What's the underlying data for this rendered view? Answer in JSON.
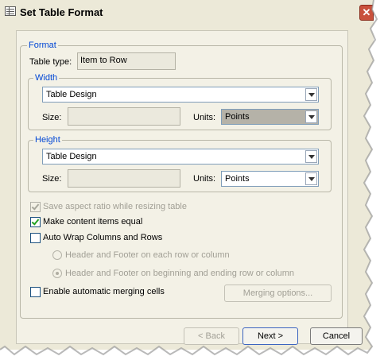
{
  "window": {
    "title": "Set Table Format",
    "close_glyph": "✕"
  },
  "format_group": {
    "legend": "Format",
    "table_type_label": "Table type:",
    "table_type_value": "Item to Row"
  },
  "width_group": {
    "legend": "Width",
    "design_value": "Table Design",
    "size_label": "Size:",
    "size_value": "",
    "units_label": "Units:",
    "units_value": "Points"
  },
  "height_group": {
    "legend": "Height",
    "design_value": "Table Design",
    "size_label": "Size:",
    "size_value": "",
    "units_label": "Units:",
    "units_value": "Points"
  },
  "options": {
    "save_aspect": {
      "label": "Save aspect ratio while resizing table",
      "checked": true,
      "enabled": false
    },
    "make_equal": {
      "label": "Make content items equal",
      "checked": true,
      "enabled": true
    },
    "auto_wrap": {
      "label": "Auto Wrap Columns and Rows",
      "checked": false,
      "enabled": true
    },
    "radio_each": {
      "label": "Header and Footer on each row or column",
      "selected": false,
      "enabled": false
    },
    "radio_begin_end": {
      "label": "Header and Footer on beginning and ending row or column",
      "selected": true,
      "enabled": false
    },
    "auto_merge": {
      "label": "Enable automatic merging cells",
      "checked": false,
      "enabled": true
    },
    "merging_options_label": "Merging options..."
  },
  "buttons": {
    "back": "< Back",
    "next": "Next >",
    "cancel": "Cancel"
  }
}
